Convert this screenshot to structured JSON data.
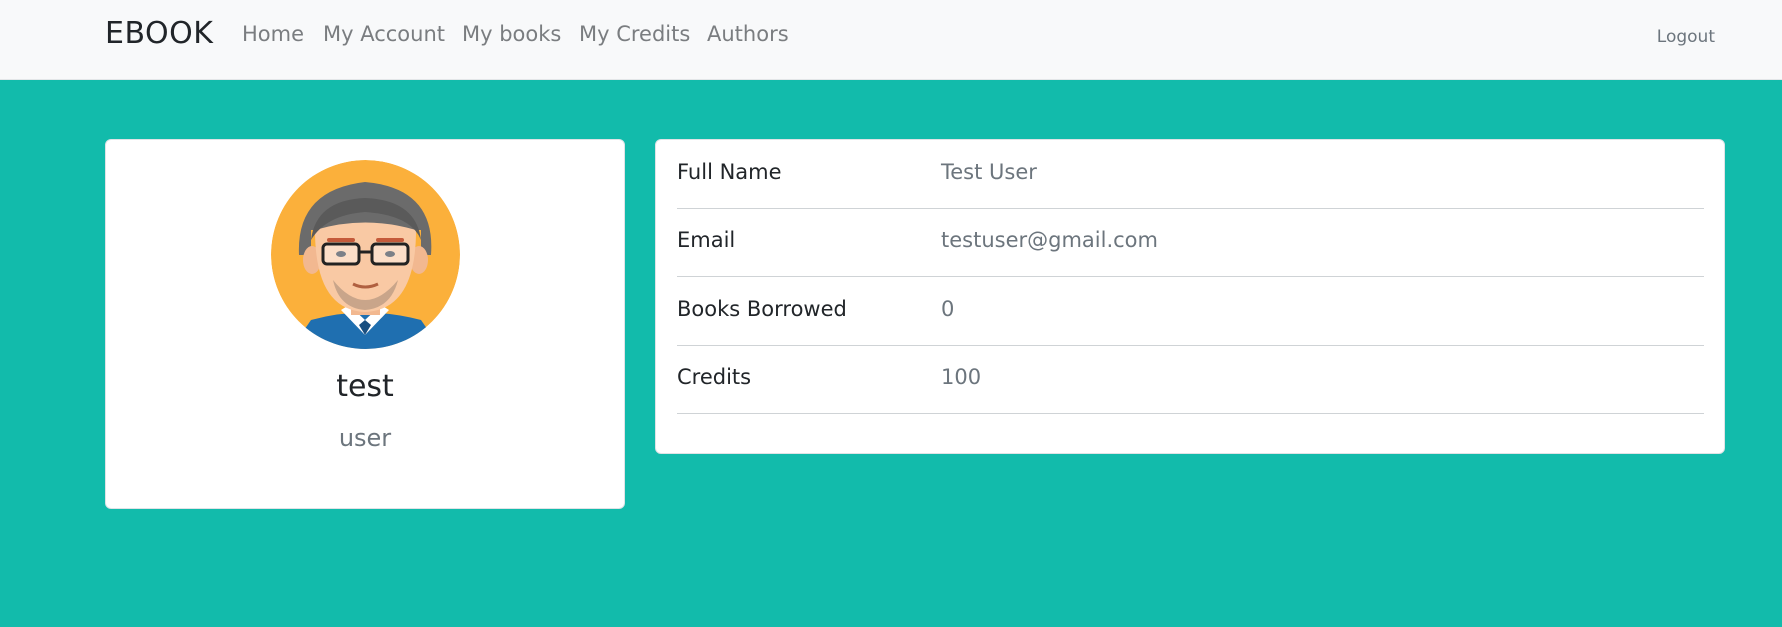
{
  "navbar": {
    "brand": "EBOOK",
    "links": [
      {
        "label": "Home"
      },
      {
        "label": "My Account"
      },
      {
        "label": "My books"
      },
      {
        "label": "My Credits"
      },
      {
        "label": "Authors"
      }
    ],
    "logout_label": "Logout"
  },
  "profile": {
    "avatar_icon": "user-avatar-icon",
    "name": "test",
    "role": "user"
  },
  "details": {
    "rows": [
      {
        "label": "Full Name",
        "value": "Test User"
      },
      {
        "label": "Email",
        "value": "testuser@gmail.com"
      },
      {
        "label": "Books Borrowed",
        "value": "0"
      },
      {
        "label": "Credits",
        "value": "100"
      }
    ]
  },
  "colors": {
    "background": "#12bbab",
    "navbar": "#f8f9fa",
    "card": "#ffffff",
    "avatar_bg": "#fbb03b"
  }
}
